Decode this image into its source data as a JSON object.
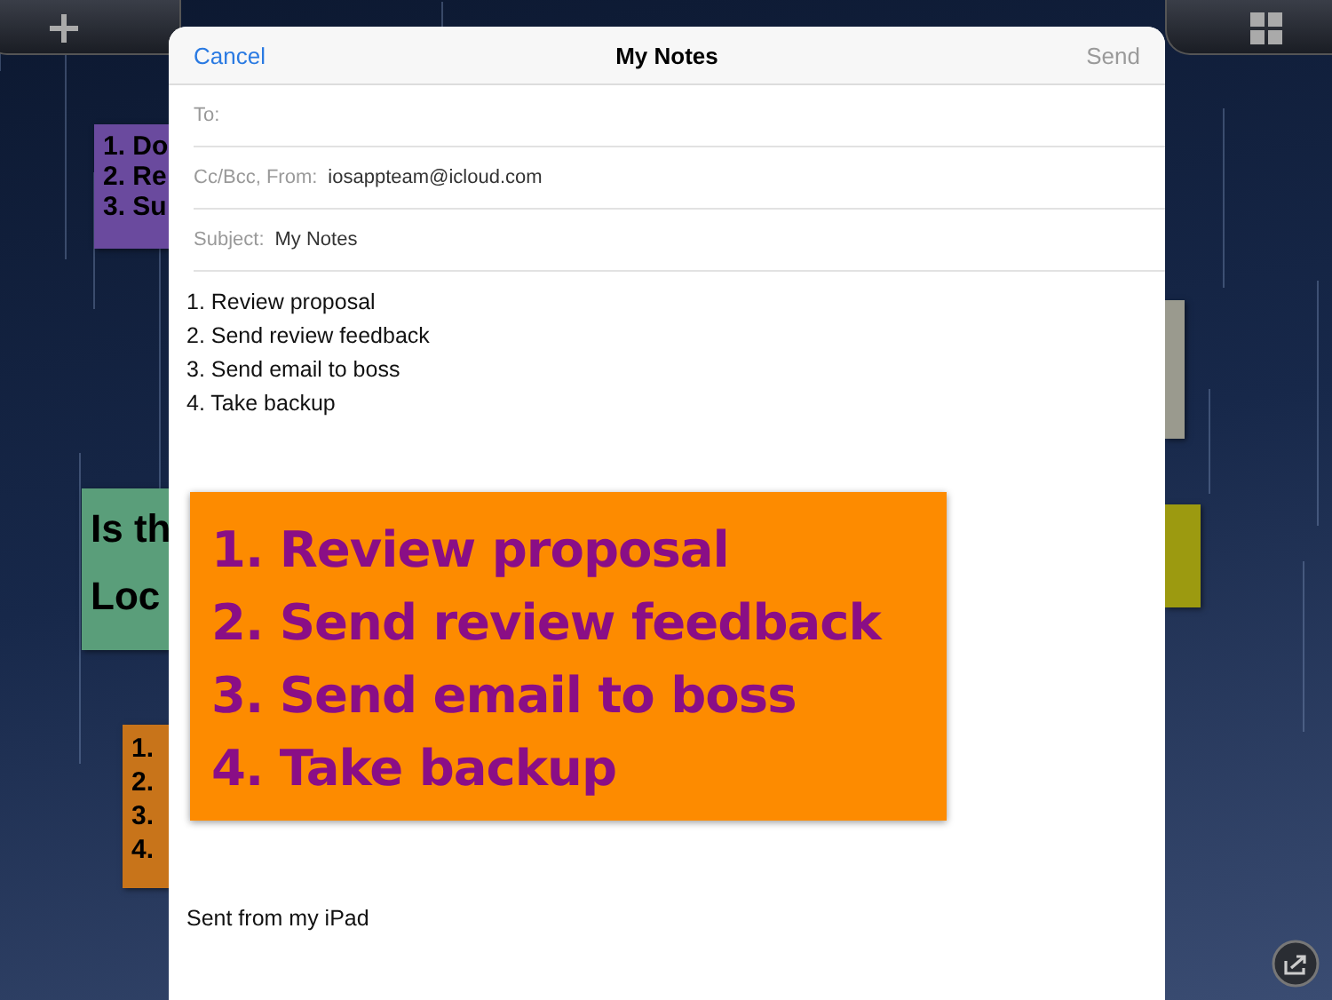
{
  "background_notes": [
    {
      "color": "#6a4a9e",
      "lines": [
        "1. Do",
        "2. Re",
        "3. Su"
      ]
    },
    {
      "color": "#5a9e7a",
      "lines": [
        "Is th",
        "Loc"
      ]
    },
    {
      "color": "#c8741a",
      "lines": [
        "1.",
        "2.",
        "3.",
        "4."
      ]
    },
    {
      "color": "#9a9a8e"
    },
    {
      "color": "#9c9a10"
    }
  ],
  "compose": {
    "cancel": "Cancel",
    "title": "My Notes",
    "send": "Send",
    "send_disabled": true,
    "fields": [
      {
        "label": "To:"
      },
      {
        "label": "Cc/Bcc, From:",
        "value": "iosappteam@icloud.com"
      },
      {
        "label": "Subject:",
        "value": "My Notes"
      }
    ],
    "body_lines": [
      "1. Review proposal",
      "2. Send review feedback",
      "3. Send email to boss",
      "4. Take backup"
    ],
    "attachment": {
      "lines": [
        "1. Review proposal",
        "2. Send review feedback",
        "3. Send email to boss",
        "4. Take backup"
      ]
    },
    "signature": "Sent from my iPad"
  }
}
